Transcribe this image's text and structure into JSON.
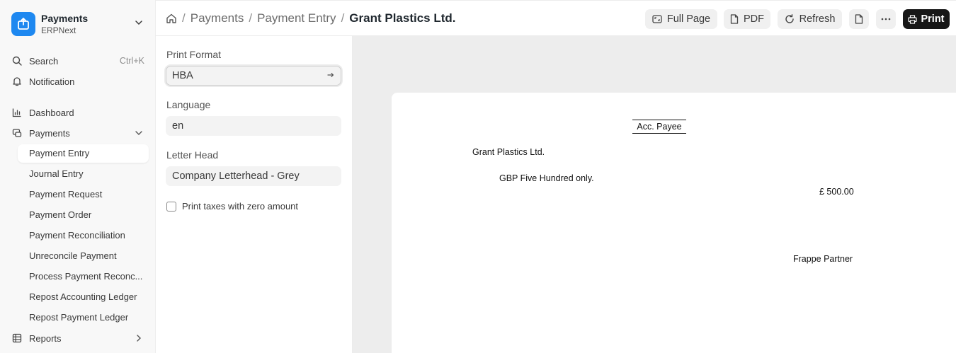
{
  "app": {
    "name": "Payments",
    "subtitle": "ERPNext",
    "brand_color": "#1e88f0"
  },
  "sidebar": {
    "search_label": "Search",
    "search_shortcut": "Ctrl+K",
    "notification_label": "Notification",
    "dashboard_label": "Dashboard",
    "payments_label": "Payments",
    "payments_items": [
      {
        "label": "Payment Entry",
        "active": true
      },
      {
        "label": "Journal Entry"
      },
      {
        "label": "Payment Request"
      },
      {
        "label": "Payment Order"
      },
      {
        "label": "Payment Reconciliation"
      },
      {
        "label": "Unreconcile Payment"
      },
      {
        "label": "Process Payment Reconc..."
      },
      {
        "label": "Repost Accounting Ledger"
      },
      {
        "label": "Repost Payment Ledger"
      }
    ],
    "reports_label": "Reports"
  },
  "breadcrumb": {
    "items": [
      "Payments",
      "Payment Entry"
    ],
    "current": "Grant Plastics Ltd."
  },
  "toolbar": {
    "full_page_label": "Full Page",
    "pdf_label": "PDF",
    "refresh_label": "Refresh",
    "print_label": "Print"
  },
  "settings": {
    "print_format_label": "Print Format",
    "print_format_value": "HBA",
    "language_label": "Language",
    "language_value": "en",
    "letter_head_label": "Letter Head",
    "letter_head_value": "Company Letterhead - Grey",
    "zero_taxes_label": "Print taxes with zero amount",
    "zero_taxes_checked": false
  },
  "preview": {
    "acc_payee": "Acc. Payee",
    "payee_name": "Grant Plastics Ltd.",
    "amount_in_words": "GBP Five Hundred only.",
    "amount": "£ 500.00",
    "signatory": "Frappe Partner"
  }
}
